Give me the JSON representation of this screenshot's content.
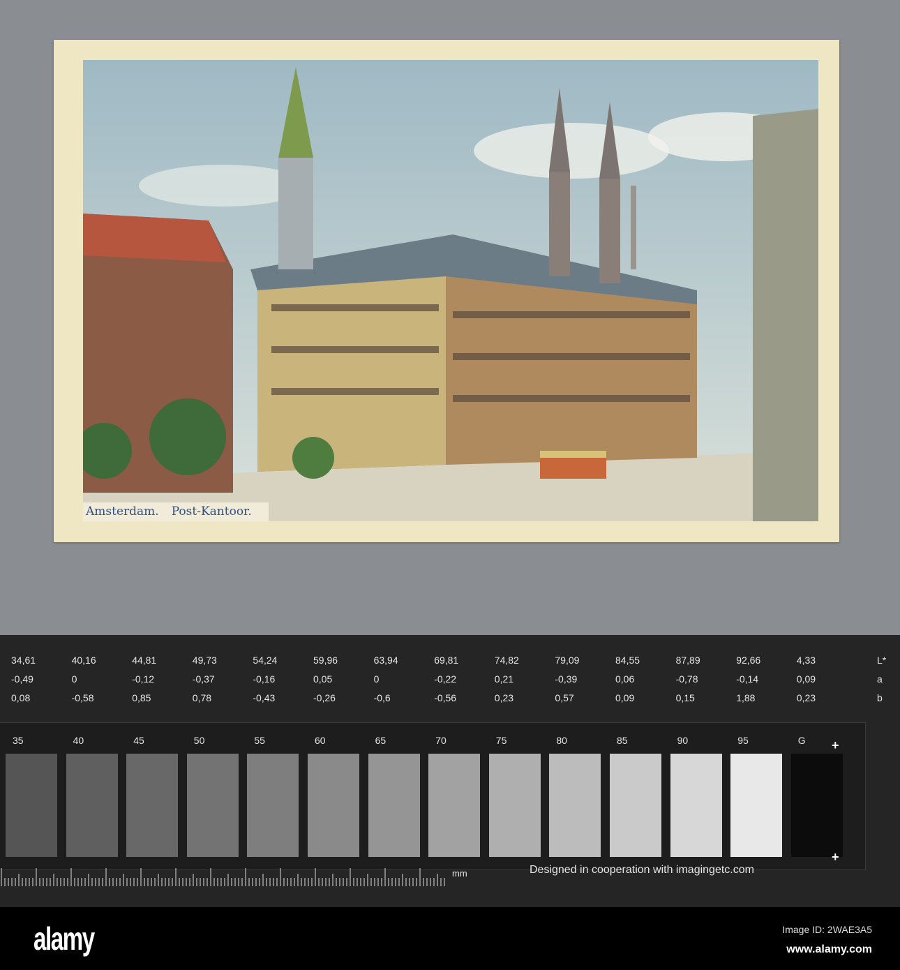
{
  "postcard": {
    "caption": {
      "city": "Amsterdam.",
      "subject": "Post-Kantoor."
    }
  },
  "color_chart": {
    "L_values": [
      "34,61",
      "40,16",
      "44,81",
      "49,73",
      "54,24",
      "59,96",
      "63,94",
      "69,81",
      "74,82",
      "79,09",
      "84,55",
      "87,89",
      "92,66",
      "4,33"
    ],
    "a_values": [
      "-0,49",
      "0",
      "-0,12",
      "-0,37",
      "-0,16",
      "0,05",
      "0",
      "-0,22",
      "0,21",
      "-0,39",
      "0,06",
      "-0,78",
      "-0,14",
      "0,09"
    ],
    "b_values": [
      "0,08",
      "-0,58",
      "0,85",
      "0,78",
      "-0,43",
      "-0,26",
      "-0,6",
      "-0,56",
      "0,23",
      "0,57",
      "0,09",
      "0,15",
      "1,88",
      "0,23"
    ],
    "row_labels": [
      "L*",
      "a",
      "b"
    ],
    "patch_labels": [
      "35",
      "40",
      "45",
      "50",
      "55",
      "60",
      "65",
      "70",
      "75",
      "80",
      "85",
      "90",
      "95",
      "G"
    ],
    "patch_colors": [
      "#555555",
      "#5f5f5f",
      "#686868",
      "#737373",
      "#7e7e7e",
      "#8a8a8a",
      "#959595",
      "#a2a2a2",
      "#afafaf",
      "#bcbcbc",
      "#cacaca",
      "#d7d7d7",
      "#e8e8e8",
      "#0c0c0c"
    ],
    "ruler_unit": "mm",
    "credit": "Designed in cooperation with imagingetc.com"
  },
  "footer": {
    "logo": "alamy",
    "image_id": "Image ID: 2WAE3A5",
    "url": "www.alamy.com"
  }
}
